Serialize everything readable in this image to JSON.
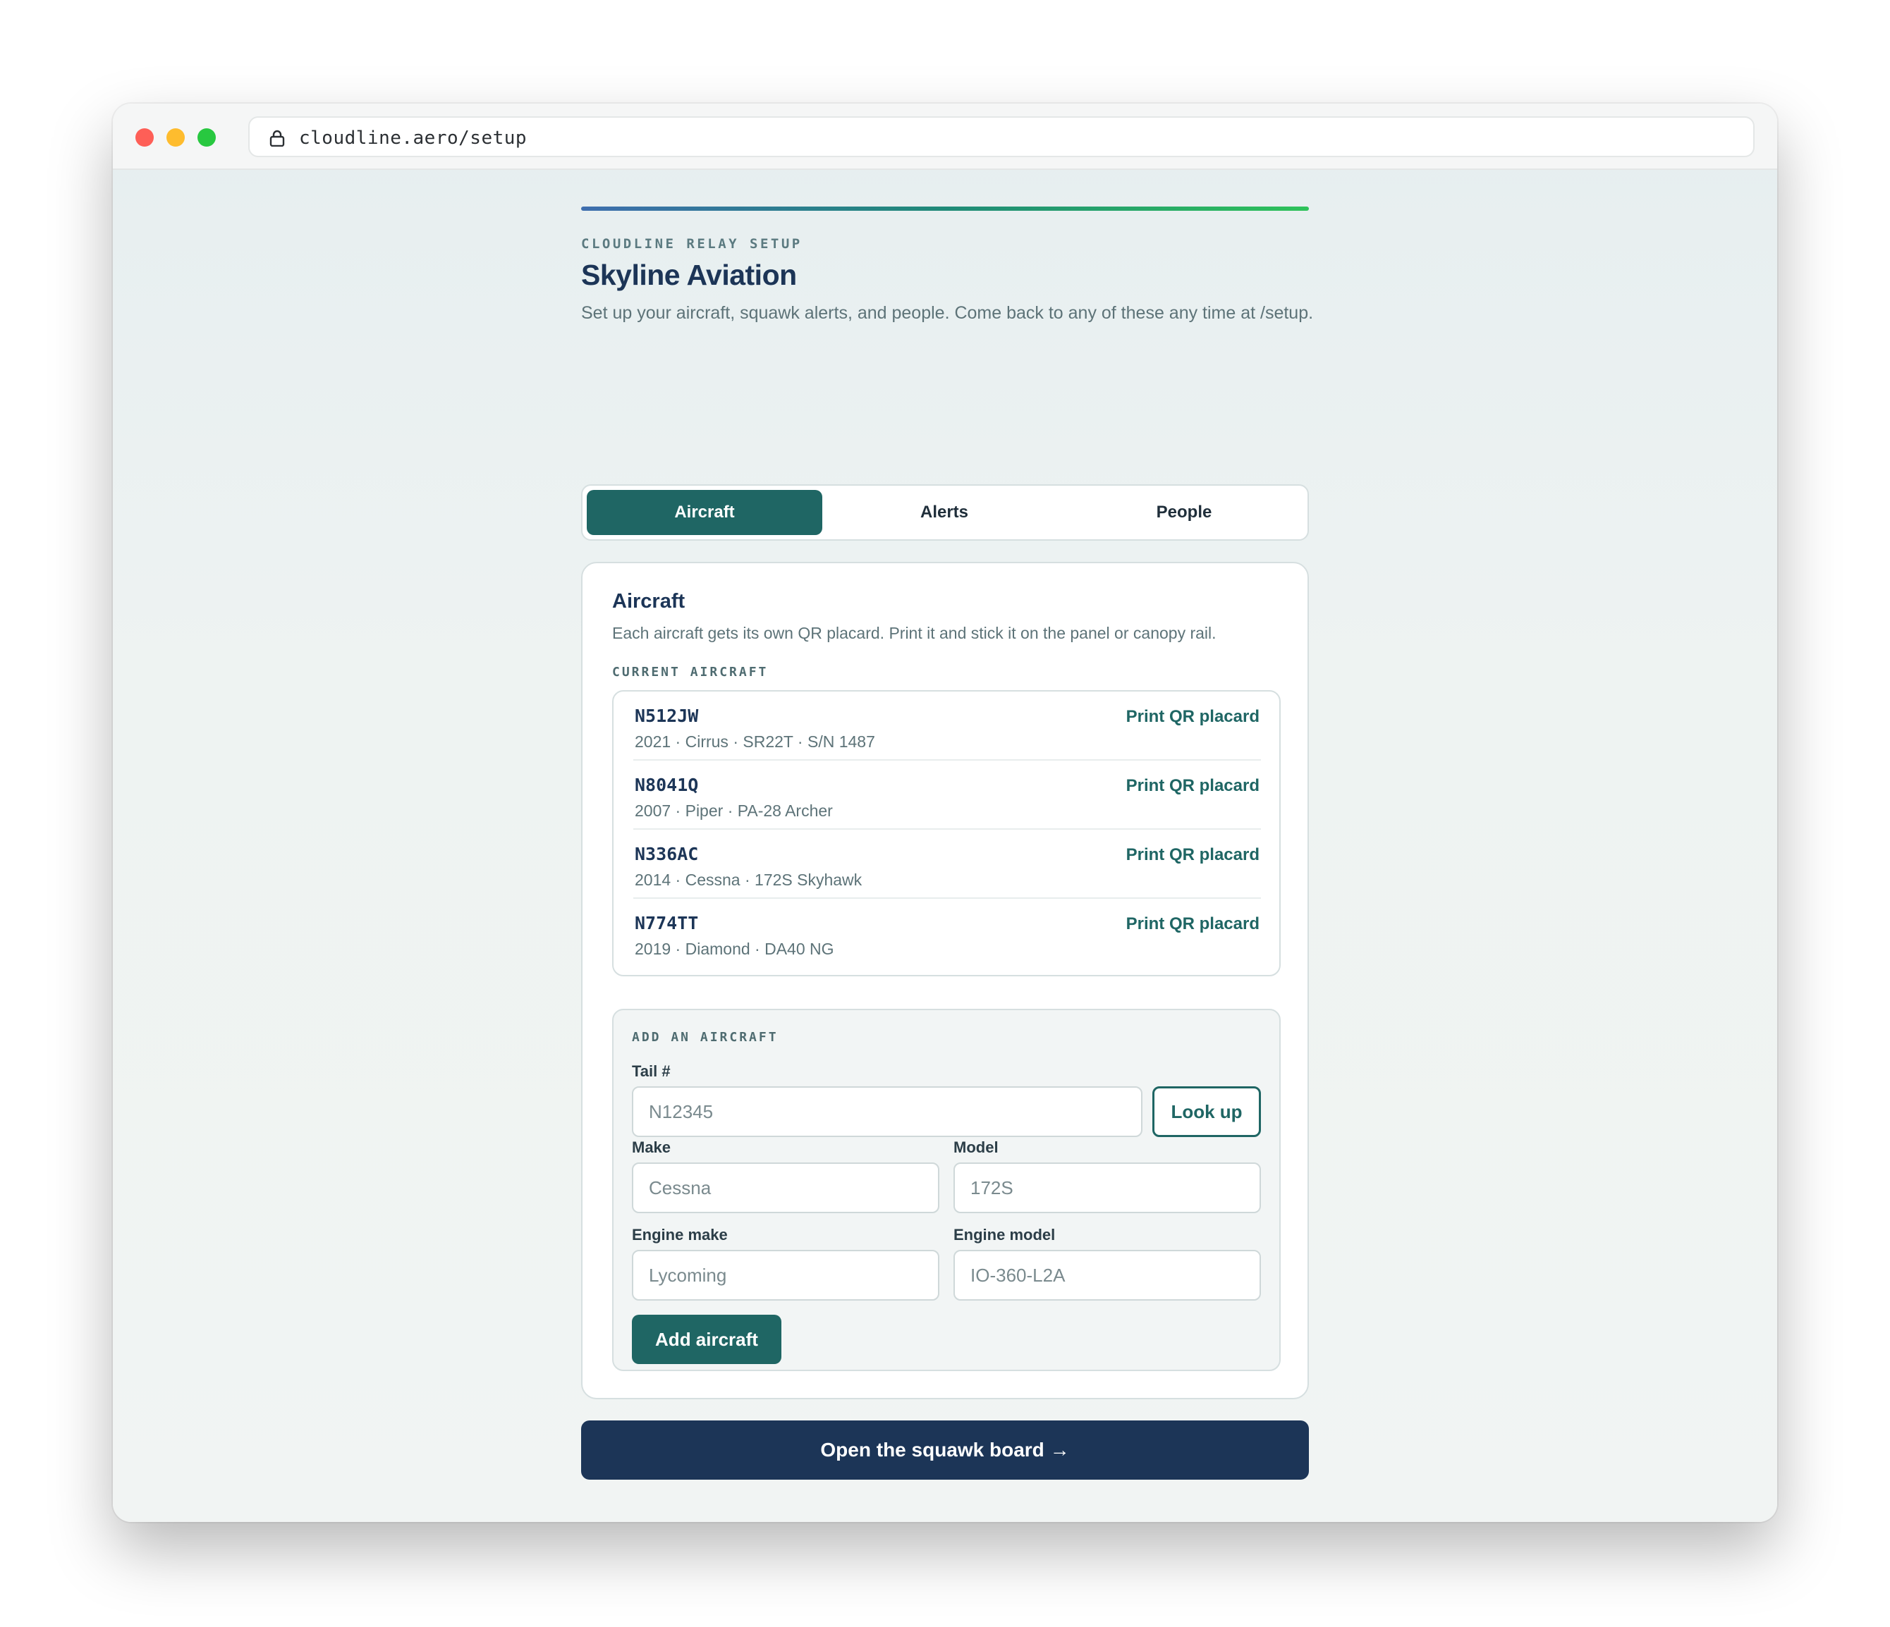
{
  "browser": {
    "url": "cloudline.aero/setup",
    "icons": {
      "lock": "lock-icon"
    }
  },
  "header": {
    "eyebrow": "CLOUDLINE RELAY SETUP",
    "title": "Skyline Aviation",
    "subtitle": "Set up your aircraft, squawk alerts, and people. Come back to any of these any time at /setup."
  },
  "tabs": [
    {
      "label": "Aircraft",
      "active": true
    },
    {
      "label": "Alerts",
      "active": false
    },
    {
      "label": "People",
      "active": false
    }
  ],
  "aircraft_card": {
    "title": "Aircraft",
    "description": "Each aircraft gets its own QR placard. Print it and stick it on the panel or canopy rail.",
    "current_label": "CURRENT AIRCRAFT",
    "items": [
      {
        "tail": "N512JW",
        "meta": "2021 · Cirrus · SR22T · S/N 1487",
        "action": "Print QR placard"
      },
      {
        "tail": "N8041Q",
        "meta": "2007 · Piper · PA-28 Archer",
        "action": "Print QR placard"
      },
      {
        "tail": "N336AC",
        "meta": "2014 · Cessna · 172S Skyhawk",
        "action": "Print QR placard"
      },
      {
        "tail": "N774TT",
        "meta": "2019 · Diamond · DA40 NG",
        "action": "Print QR placard"
      }
    ]
  },
  "add_form": {
    "section_label": "ADD AN AIRCRAFT",
    "tail": {
      "label": "Tail #",
      "placeholder": "N12345",
      "value": ""
    },
    "lookup_label": "Look up",
    "make": {
      "label": "Make",
      "placeholder": "Cessna",
      "value": ""
    },
    "model": {
      "label": "Model",
      "placeholder": "172S",
      "value": ""
    },
    "engine_make": {
      "label": "Engine make",
      "placeholder": "Lycoming",
      "value": ""
    },
    "engine_model": {
      "label": "Engine model",
      "placeholder": "IO-360-L2A",
      "value": ""
    },
    "submit_label": "Add aircraft"
  },
  "footer": {
    "board_button": "Open the squawk board →"
  },
  "colors": {
    "accent": "#1f6664",
    "navy": "#1c3557",
    "muted": "#5d7378",
    "progress_start": "#3e6eae",
    "progress_end": "#2ec25a"
  }
}
